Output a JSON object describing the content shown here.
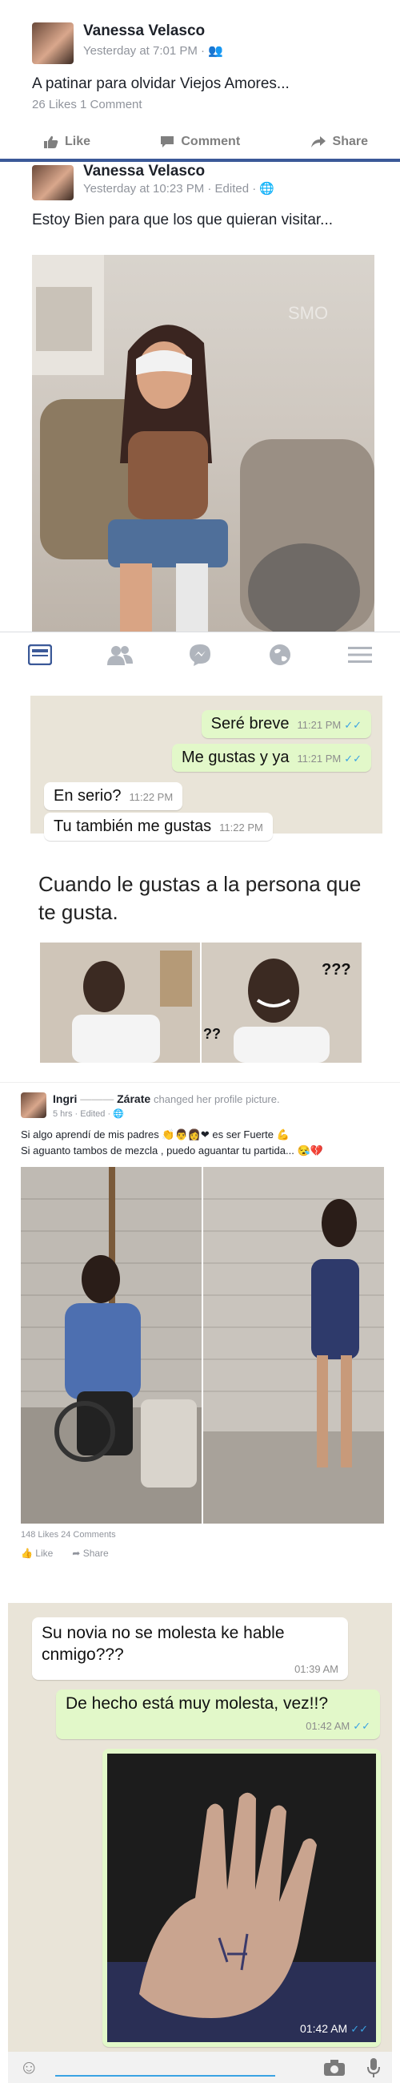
{
  "post1": {
    "author": "Vanessa Velasco",
    "time": "Yesterday at 7:01 PM · ",
    "text": "A patinar para olvidar Viejos Amores...",
    "stats": "26 Likes   1 Comment",
    "like": "Like",
    "comment": "Comment",
    "share": "Share"
  },
  "post2": {
    "author": "Vanessa Velasco",
    "time": "Yesterday at 10:23 PM · Edited · ",
    "text": "Estoy Bien  para que los que quieran visitar...",
    "watermark": "SMO"
  },
  "chat1": {
    "messages": [
      {
        "dir": "out",
        "text": "Seré breve",
        "time": "11:21 PM"
      },
      {
        "dir": "out",
        "text": "Me gustas y ya",
        "time": "11:21 PM"
      },
      {
        "dir": "in",
        "text": "En serio?",
        "time": "11:22 PM"
      },
      {
        "dir": "in",
        "text": "Tu también me gustas",
        "time": "11:22 PM"
      }
    ]
  },
  "meme": {
    "caption": "Cuando le gustas a la persona que te gusta.",
    "q1": "???",
    "q2": "??"
  },
  "post3": {
    "author_left": "Ingri",
    "author_right": "Zárate",
    "action": "changed her profile picture.",
    "time": "5 hrs · Edited · ",
    "line1": "Si algo aprendí de mis padres ",
    "line1_end": " es ser Fuerte ",
    "line2": "Si aguanto tambos de mezcla , puedo aguantar tu partida... ",
    "stats": "148 Likes  24 Comments",
    "like": "Like",
    "share": "Share"
  },
  "chat2": {
    "msg_in": "Su novia no se molesta ke hable cnmigo???",
    "time_in": "01:39 AM",
    "msg_out": "De hecho está muy molesta, vez!!?",
    "time_out": "01:42 AM",
    "photo_time": "01:42 AM"
  },
  "colors": {
    "fb_blue": "#3b5998",
    "wa_out": "#e2f8c9",
    "wa_bg": "#e9e4d8",
    "tick_blue": "#3aa3e3"
  }
}
